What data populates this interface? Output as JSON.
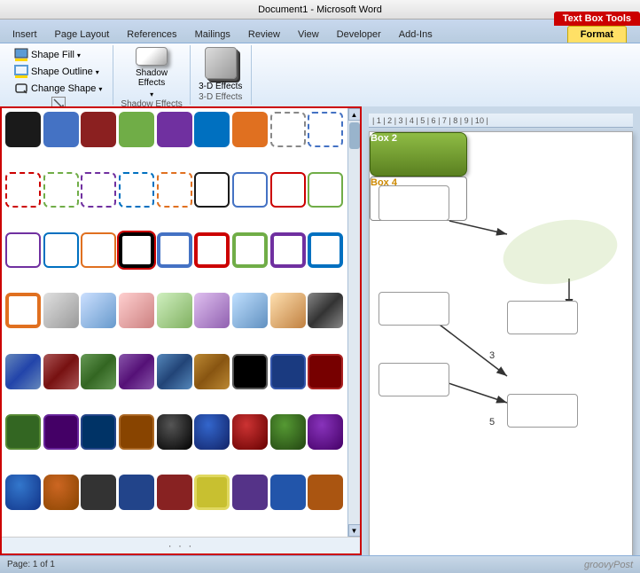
{
  "titlebar": {
    "text": "Document1 - Microsoft Word"
  },
  "ribbon": {
    "tabs": [
      {
        "label": "Insert",
        "active": false
      },
      {
        "label": "Page Layout",
        "active": false
      },
      {
        "label": "References",
        "active": false
      },
      {
        "label": "Mailings",
        "active": false
      },
      {
        "label": "Review",
        "active": false
      },
      {
        "label": "View",
        "active": false
      },
      {
        "label": "Developer",
        "active": false
      },
      {
        "label": "Add-Ins",
        "active": false
      }
    ],
    "contextual_tab_group": "Text Box Tools",
    "contextual_tab": "Format",
    "sections": {
      "shapes": {
        "label": "Shadow Effects",
        "buttons": [
          {
            "label": "Shape Fill",
            "icon": "fill-icon"
          },
          {
            "label": "Shape Outline",
            "icon": "outline-icon"
          },
          {
            "label": "Change Shape",
            "icon": "shape-icon"
          }
        ]
      },
      "shadow_effects": {
        "label": "Shadow Effects",
        "button_label": "Shadow Effects"
      },
      "threed_effects": {
        "label": "3-D Effects",
        "button_label": "3-D Effects"
      }
    }
  },
  "shape_picker": {
    "scrollbar": {
      "up_label": "▲",
      "down_label": "▼"
    }
  },
  "document": {
    "box2_label": "Box 2",
    "box4_label": "Box 4"
  },
  "statusbar": {
    "logo": "groovyPost"
  }
}
